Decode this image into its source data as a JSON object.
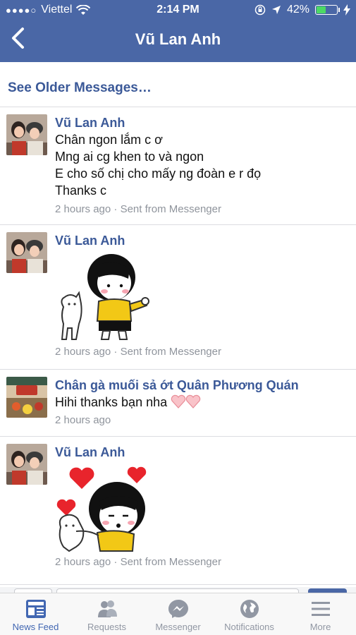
{
  "status_bar": {
    "carrier": "Viettel",
    "time": "2:14 PM",
    "battery_percent": "42%",
    "battery_level": 0.42,
    "signal_dots": "●●●●○"
  },
  "nav": {
    "back_icon": "chevron-left-icon",
    "title": "Vũ Lan Anh"
  },
  "thread": {
    "older_label": "See Older Messages…",
    "messages": [
      {
        "sender": "Vũ Lan Anh",
        "lines": [
          "Chân ngon lắm c ơ",
          "Mng ai cg khen to và ngon",
          "E cho số chị cho mấy ng đoàn e r đọ",
          "Thanks c"
        ],
        "time": "2 hours ago",
        "source": "Sent from Messenger"
      },
      {
        "sender": "Vũ Lan Anh",
        "sticker": "sticker-girl-thumbs-up-with-cat",
        "time": "2 hours ago",
        "source": "Sent from Messenger"
      },
      {
        "sender": "Chân gà muối sả ớt Quân Phương Quán",
        "text": "Hihi thanks bạn nha",
        "time": "2 hours ago"
      },
      {
        "sender": "Vũ Lan Anh",
        "sticker": "sticker-girl-kiss-with-hearts",
        "time": "2 hours ago",
        "source": "Sent from Messenger"
      }
    ]
  },
  "tabbar": {
    "tabs": [
      {
        "label": "News Feed",
        "icon": "news-feed-icon",
        "active": true
      },
      {
        "label": "Requests",
        "icon": "friend-requests-icon"
      },
      {
        "label": "Messenger",
        "icon": "messenger-icon"
      },
      {
        "label": "Notifications",
        "icon": "globe-icon"
      },
      {
        "label": "More",
        "icon": "hamburger-icon"
      }
    ]
  },
  "colors": {
    "brand": "#4a67a6",
    "link": "#3b5998",
    "active_tab": "#4267b2"
  }
}
